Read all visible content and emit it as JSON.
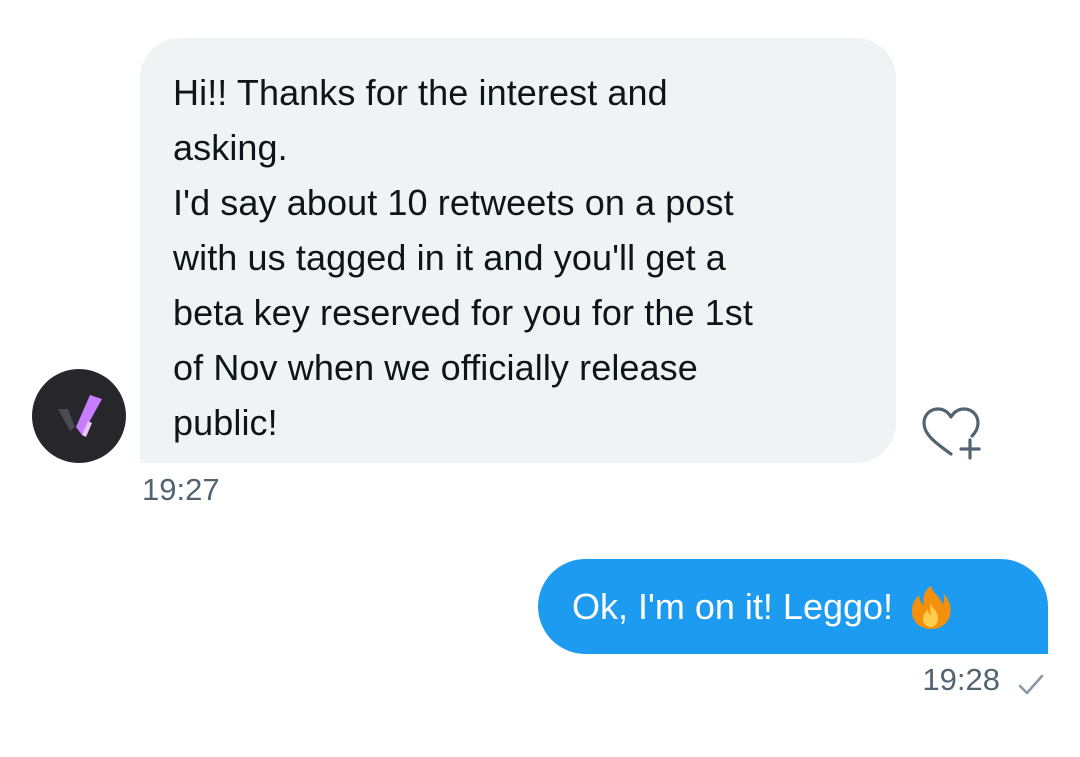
{
  "thread": {
    "messages": [
      {
        "direction": "incoming",
        "text": "Hi!! Thanks for the interest and\nasking.\nI'd say about 10 retweets on a post\nwith us tagged in it and you'll get a\nbeta key reserved for you for the 1st\nof Nov when we officially release\npublic!",
        "time": "19:27"
      },
      {
        "direction": "outgoing",
        "text": "Ok, I'm on it! Leggo!",
        "emoji": "fire-emoji",
        "time": "19:28",
        "status": "sent-check-icon"
      }
    ]
  },
  "colors": {
    "incoming_bubble": "#eff3f4",
    "outgoing_bubble": "#1d9bf0",
    "timestamp": "#536471",
    "avatar_bg": "#26262b",
    "avatar_mark": "#c77dff"
  }
}
